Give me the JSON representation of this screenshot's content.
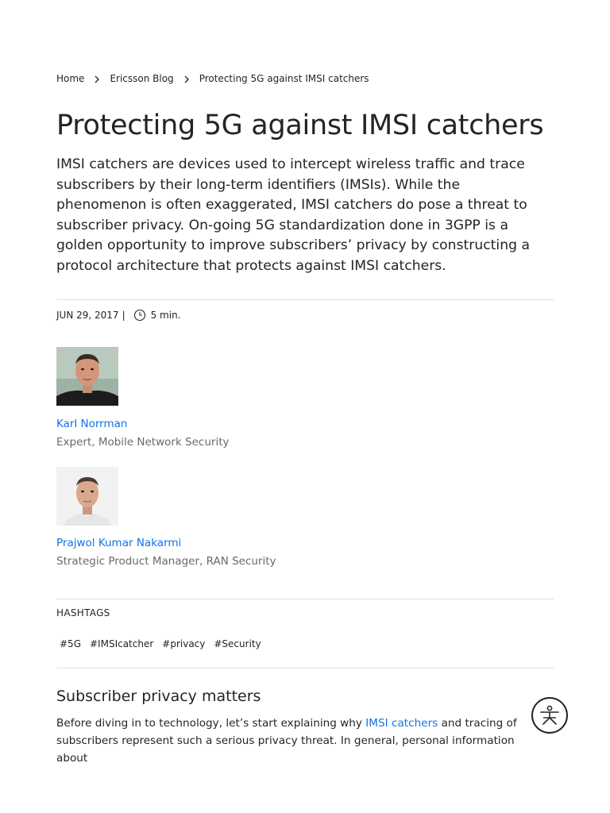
{
  "breadcrumb": {
    "items": [
      "Home",
      "Ericsson Blog",
      "Protecting 5G against IMSI catchers"
    ]
  },
  "article": {
    "title": "Protecting 5G against IMSI catchers",
    "lead": "IMSI catchers are devices used to intercept wireless traffic and trace subscribers by their long-term identifiers (IMSIs). While the phenomenon is often exaggerated, IMSI catchers do pose a threat to subscriber privacy. On-going 5G standardization done in 3GPP is a golden opportunity to improve subscribers’ privacy by constructing a protocol architecture that protects against IMSI catchers.",
    "date": "JUN 29, 2017",
    "separator": "|",
    "read_time": "5 min."
  },
  "authors": [
    {
      "name": "Karl Norrman",
      "role": "Expert, Mobile Network Security"
    },
    {
      "name": "Prajwol Kumar Nakarmi",
      "role": "Strategic Product Manager, RAN Security"
    }
  ],
  "hashtags": {
    "label": "HASHTAGS",
    "items": [
      "#5G",
      "#IMSIcatcher",
      "#privacy",
      "#Security"
    ]
  },
  "section": {
    "heading": "Subscriber privacy matters",
    "text_before": "Before diving in to technology, let’s start explaining why ",
    "link": "IMSI catchers",
    "text_after": " and tracing of subscribers represent such a serious privacy threat. In general, personal information about"
  },
  "accessibility_button": {
    "icon": "accessibility-icon"
  },
  "colors": {
    "link": "#1174e6",
    "text": "#242424",
    "muted": "#6a6a6a",
    "rule": "#e0e0e0"
  }
}
